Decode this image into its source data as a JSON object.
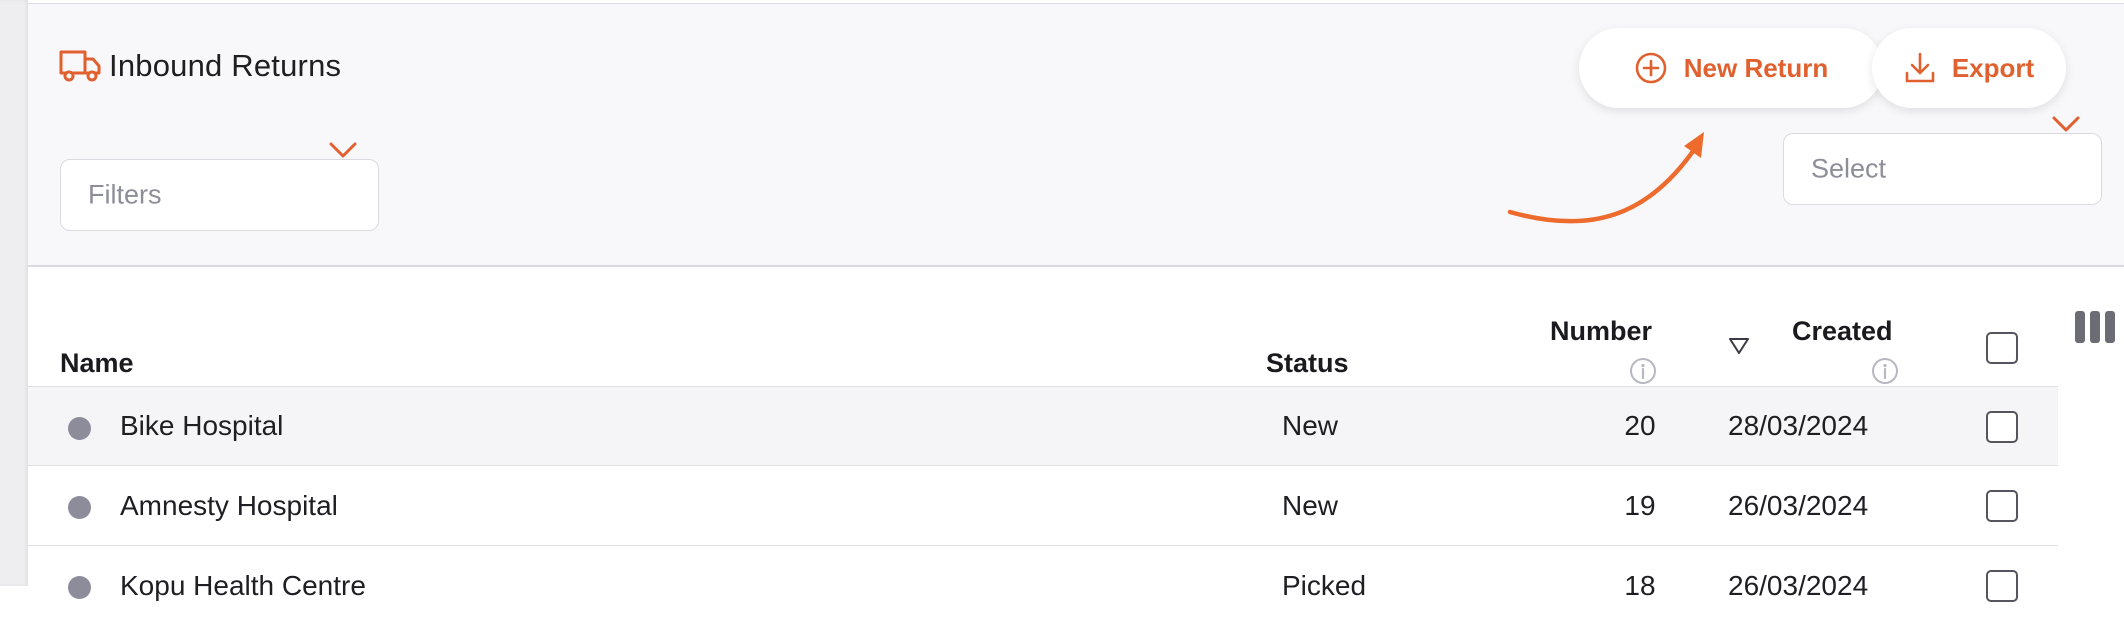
{
  "header": {
    "title": "Inbound Returns",
    "title_icon": "truck-icon",
    "new_return_label": "New Return",
    "export_label": "Export",
    "filters_placeholder": "Filters",
    "sort_placeholder": "Select"
  },
  "table": {
    "columns": {
      "name": "Name",
      "status": "Status",
      "number": "Number",
      "created": "Created"
    },
    "rows": [
      {
        "name": "Bike Hospital",
        "status": "New",
        "number": "20",
        "created": "28/03/2024"
      },
      {
        "name": "Amnesty Hospital",
        "status": "New",
        "number": "19",
        "created": "26/03/2024"
      },
      {
        "name": "Kopu Health Centre",
        "status": "Picked",
        "number": "18",
        "created": "26/03/2024"
      }
    ]
  },
  "colors": {
    "accent": "#e0612f",
    "annotation_arrow": "#ec6b2d",
    "status_dot": "#8d8c9b"
  }
}
